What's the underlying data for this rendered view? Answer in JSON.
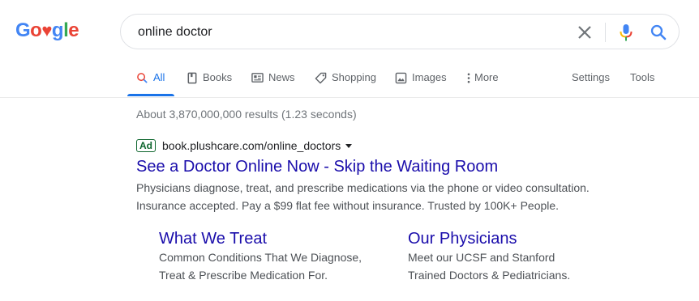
{
  "logo": {
    "letters": [
      "G",
      "o",
      "♥",
      "g",
      "l",
      "e"
    ]
  },
  "search": {
    "query": "online doctor"
  },
  "tabs": [
    {
      "label": "All",
      "icon": "search-icon"
    },
    {
      "label": "Books",
      "icon": "book-icon"
    },
    {
      "label": "News",
      "icon": "news-icon"
    },
    {
      "label": "Shopping",
      "icon": "tag-icon"
    },
    {
      "label": "Images",
      "icon": "image-icon"
    },
    {
      "label": "More",
      "icon": "more-vert-icon"
    }
  ],
  "tools": {
    "settings": "Settings",
    "tools": "Tools"
  },
  "results": {
    "stats": "About 3,870,000,000 results (1.23 seconds)"
  },
  "ad": {
    "badge": "Ad",
    "url": "book.plushcare.com/online_doctors",
    "title": "See a Doctor Online Now - Skip the Waiting Room",
    "description_lines": [
      "Physicians diagnose, treat, and prescribe medications via the phone or video consultation.",
      "Insurance accepted. Pay a $99 flat fee without insurance. Trusted by 100K+ People."
    ],
    "sitelinks": [
      {
        "title": "What We Treat",
        "lines": [
          "Common Conditions That We Diagnose,",
          "Treat & Prescribe Medication For."
        ]
      },
      {
        "title": "Our Physicians",
        "lines": [
          "Meet our UCSF and Stanford",
          "Trained Doctors & Pediatricians."
        ]
      }
    ]
  },
  "colors": {
    "link": "#1a0dab",
    "accent": "#1a73e8",
    "ad_green": "#0d652d"
  }
}
